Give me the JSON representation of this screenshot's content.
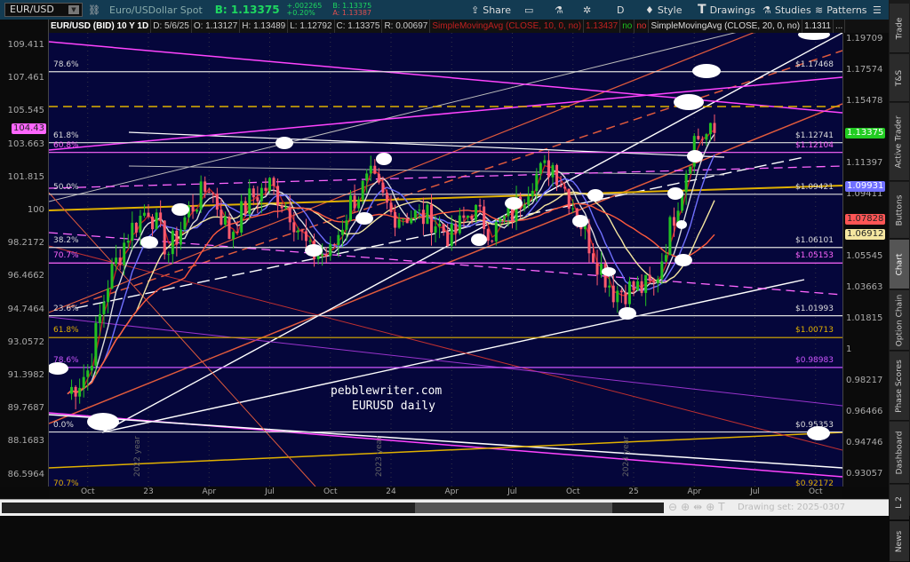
{
  "header": {
    "symbol": "EUR/USD",
    "description": "Euro/USDollar Spot",
    "bid_label": "B: 1.13375",
    "change_abs": "+.002265",
    "change_pct": "+0.20%",
    "bid_small": "B: 1.13375",
    "ask_small": "A: 1.13387",
    "toolbar": [
      {
        "label": "Share",
        "icon": "share-icon"
      },
      {
        "label": "",
        "icon": "alert-icon"
      },
      {
        "label": "",
        "icon": "flask-icon"
      },
      {
        "label": "",
        "icon": "gear-icon"
      },
      {
        "label": "D",
        "icon": "aggregation"
      },
      {
        "label": "Style",
        "icon": "candle-icon"
      },
      {
        "label": "Drawings",
        "icon": "text-t-icon"
      },
      {
        "label": "Studies",
        "icon": "flask-icon"
      },
      {
        "label": "Patterns",
        "icon": "patterns-icon"
      },
      {
        "label": "",
        "icon": "menu-icon"
      }
    ]
  },
  "studybar": {
    "title": "EUR/USD (BID) 10 Y 1D",
    "date": "D: 5/6/25",
    "open": "O: 1.13127",
    "high": "H: 1.13489",
    "low": "L: 1.12792",
    "close": "C: 1.13375",
    "range": "R: 0.00697",
    "sma10": "SimpleMovingAvg (CLOSE, 10, 0, no)",
    "sma10_val": "1.13437",
    "no1": "no",
    "no2": "no",
    "sma20": "SimpleMovingAvg (CLOSE, 20, 0, no)",
    "sma20_val": "1.1311",
    "more": "..."
  },
  "left_axis": {
    "ticks": [
      "109.411",
      "107.461",
      "105.545",
      "103.663",
      "101.815",
      "100",
      "98.2172",
      "96.4662",
      "94.7464",
      "93.0572",
      "91.3982",
      "89.7687",
      "88.1683",
      "86.5964"
    ],
    "badge": "104.43",
    "badge_color": "#ff66ff"
  },
  "right_axis": {
    "ticks": [
      1.19709,
      1.17574,
      1.15478,
      1.11397,
      1.09411,
      1.05545,
      1.03663,
      1.01815,
      1,
      0.98217,
      0.96466,
      0.94746,
      0.93057
    ],
    "badges": [
      {
        "value": "1.13375",
        "color": "#22cc22",
        "text_color": "#fff",
        "price": 1.13375
      },
      {
        "value": "1.09931",
        "color": "#7070ff",
        "text_color": "#fff",
        "price": 1.09931
      },
      {
        "value": "1.07828",
        "color": "#ff5555",
        "text_color": "#222",
        "price": 1.07828
      },
      {
        "value": "1.06912",
        "color": "#f5e6a0",
        "text_color": "#222",
        "price": 1.06912
      }
    ]
  },
  "fib_levels": [
    {
      "pct": "78.6%",
      "label": "$1.17468",
      "price": 1.17468,
      "color": "#dddddd"
    },
    {
      "pct": "61.8%",
      "label": "$1.12741",
      "price": 1.12741,
      "color": "#dddddd"
    },
    {
      "pct": "60.8%",
      "label": "$1.12104",
      "price": 1.12104,
      "color": "#ff66ff"
    },
    {
      "pct": "50.0%",
      "label": "$1.09421",
      "price": 1.09421,
      "color": "#dddddd"
    },
    {
      "pct": "38.2%",
      "label": "$1.06101",
      "price": 1.06101,
      "color": "#dddddd"
    },
    {
      "pct": "70.7%",
      "label": "$1.05153",
      "price": 1.05153,
      "color": "#ff66ff"
    },
    {
      "pct": "23.6%",
      "label": "$1.01993",
      "price": 1.01993,
      "color": "#dddddd"
    },
    {
      "pct": "61.8%",
      "label": "$1.00713",
      "price": 1.00713,
      "color": "#e0b000"
    },
    {
      "pct": "78.6%",
      "label": "$0.98983",
      "price": 0.98983,
      "color": "#cc55ff"
    },
    {
      "pct": "0.0%",
      "label": "$0.95353",
      "price": 0.95353,
      "color": "#dddddd"
    },
    {
      "pct": "70.7%",
      "label": "$0.92172",
      "price": 0.92172,
      "color": "#e0b000"
    }
  ],
  "annotation": {
    "line1": "pebblewriter.com",
    "line2": "EURUSD daily"
  },
  "year_labels": [
    "2022 year",
    "2023 year",
    "2024 year"
  ],
  "chart_data": {
    "type": "candlestick",
    "title": "EUR/USD (BID) 10 Y 1D",
    "x_start": "2022-09",
    "x_ticks": [
      "Oct",
      "23",
      "Apr",
      "Jul",
      "Oct",
      "24",
      "Apr",
      "Jul",
      "Oct",
      "25",
      "Apr",
      "Jul",
      "Oct"
    ],
    "ylim": [
      0.93057,
      1.19709
    ],
    "y_scale": "log",
    "monthly_close": [
      0.975,
      0.988,
      1.04,
      1.07,
      1.086,
      1.058,
      1.084,
      1.1,
      1.069,
      1.091,
      1.1,
      1.084,
      1.057,
      1.057,
      1.089,
      1.104,
      1.082,
      1.081,
      1.079,
      1.067,
      1.085,
      1.071,
      1.082,
      1.105,
      1.113,
      1.088,
      1.058,
      1.035,
      1.036,
      1.037,
      1.082,
      1.13,
      1.13375
    ]
  },
  "bottom": {
    "drawing_set": "Drawing set: 2025-0307"
  },
  "sidebar": {
    "tabs": [
      "Trade",
      "T&S",
      "Active Trader",
      "Buttons",
      "Chart",
      "Option Chain",
      "Phase Scores",
      "Dashboard",
      "L 2",
      "News"
    ],
    "selected": "Chart"
  }
}
